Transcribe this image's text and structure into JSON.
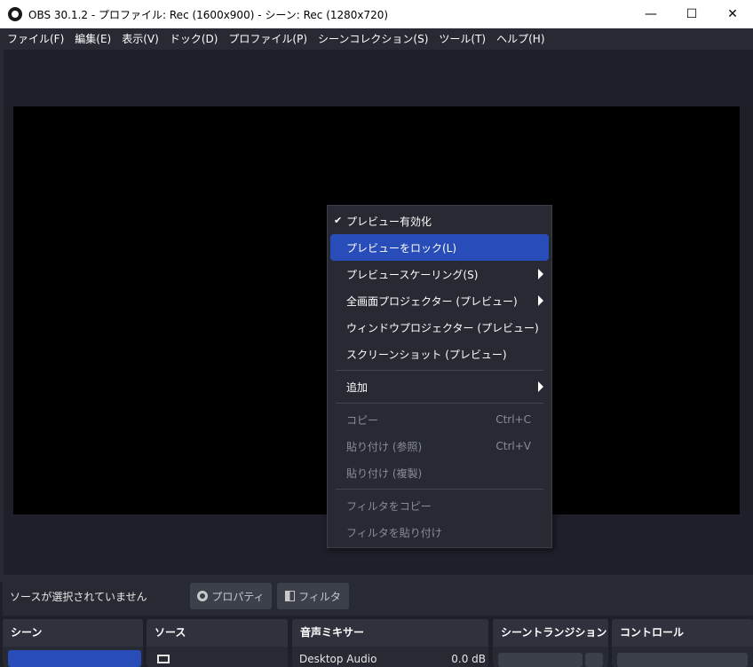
{
  "window": {
    "title": "OBS 30.1.2 - プロファイル: Rec (1600x900) - シーン: Rec (1280x720)",
    "minimize_icon": "minimize-icon",
    "maximize_icon": "maximize-icon",
    "close_icon": "close-icon"
  },
  "menubar": {
    "items": [
      "ファイル(F)",
      "編集(E)",
      "表示(V)",
      "ドック(D)",
      "プロファイル(P)",
      "シーンコレクション(S)",
      "ツール(T)",
      "ヘルプ(H)"
    ]
  },
  "context_menu": {
    "items": [
      {
        "label": "プレビュー有効化",
        "checked": true
      },
      {
        "label": "プレビューをロック(L)",
        "highlighted": true
      },
      {
        "label": "プレビュースケーリング(S)",
        "submenu": true
      },
      {
        "label": "全画面プロジェクター (プレビュー)",
        "submenu": true
      },
      {
        "label": "ウィンドウプロジェクター (プレビュー)"
      },
      {
        "label": "スクリーンショット (プレビュー)"
      },
      {
        "label": "追加",
        "submenu": true
      },
      {
        "label": "コピー",
        "shortcut": "Ctrl+C",
        "disabled": true
      },
      {
        "label": "貼り付け (参照)",
        "shortcut": "Ctrl+V",
        "disabled": true
      },
      {
        "label": "貼り付け (複製)",
        "disabled": true
      },
      {
        "label": "フィルタをコピー",
        "disabled": true
      },
      {
        "label": "フィルタを貼り付け",
        "disabled": true
      }
    ],
    "check_mark": "✔"
  },
  "source_toolbar": {
    "status": "ソースが選択されていません",
    "properties_label": "プロパティ",
    "filters_label": "フィルタ"
  },
  "docks": {
    "scenes": {
      "title": "シーン"
    },
    "sources": {
      "title": "ソース"
    },
    "mixer": {
      "title": "音声ミキサー",
      "channel_name": "Desktop Audio",
      "channel_level": "0.0 dB"
    },
    "transitions": {
      "title": "シーントランジション"
    },
    "controls": {
      "title": "コントロール"
    }
  },
  "colors": {
    "accent": "#284cb8",
    "background": "#1e1f29",
    "panel": "#272a33"
  }
}
